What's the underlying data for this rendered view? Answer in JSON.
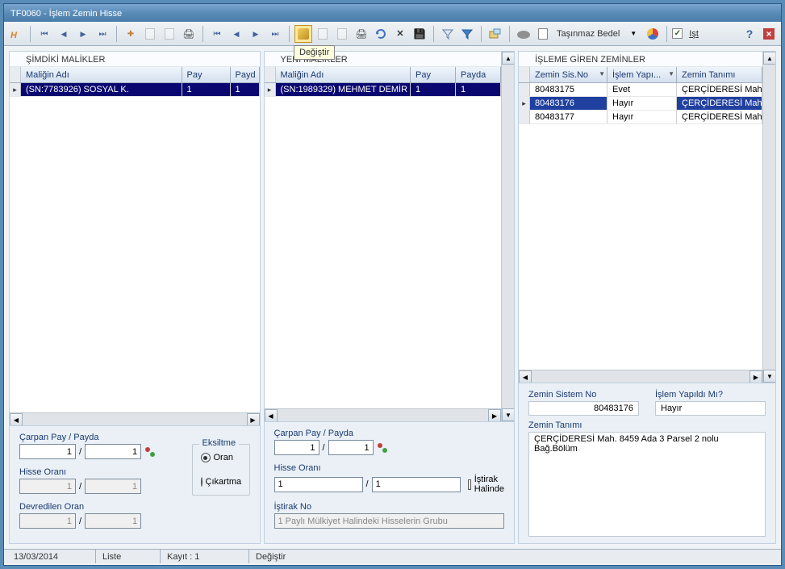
{
  "title": "TF0060 - İşlem Zemin Hisse",
  "toolbar": {
    "tasinmaz_label": "Taşınmaz Bedel",
    "ist_label": "Işt",
    "tooltip_degistir": "Değiştir"
  },
  "p1": {
    "header": "ŞİMDİKİ MALİKLER",
    "cols": {
      "c1": "Maliğin Adı",
      "c2": "Pay",
      "c3": "Payd"
    },
    "row1": {
      "name": "(SN:7783926) SOSYAL K.",
      "pay": "1",
      "payda": "1"
    },
    "form": {
      "carpan_label": "Çarpan Pay / Payda",
      "carpan_pay": "1",
      "carpan_payda": "1",
      "hisse_label": "Hisse Oranı",
      "hisse_pay": "1",
      "hisse_payda": "1",
      "devr_label": "Devredilen Oran",
      "devr_pay": "1",
      "devr_payda": "1",
      "eksiltme": "Eksiltme",
      "oran": "Oran",
      "cikartma": "Çıkartma"
    }
  },
  "p2": {
    "header": "YENİ MALİKLER",
    "cols": {
      "c1": "Maliğin Adı",
      "c2": "Pay",
      "c3": "Payda"
    },
    "row1": {
      "name": "(SN:1989329) MEHMET DEMİR",
      "pay": "1",
      "payda": "1"
    },
    "form": {
      "carpan_label": "Çarpan Pay / Payda",
      "carpan_pay": "1",
      "carpan_payda": "1",
      "hisse_label": "Hisse Oranı",
      "hisse_pay": "1",
      "hisse_payda": "1",
      "istirak_check": "İştirak Halinde",
      "istirak_no_label": "İştirak No",
      "istirak_no": "1 Paylı Mülkiyet Halindeki Hisselerin Grubu"
    }
  },
  "p3": {
    "header": "İŞLEME GİREN ZEMİNLER",
    "cols": {
      "c1": "Zemin Sis.No",
      "c2": "İşlem Yapı...",
      "c3": "Zemin Tanımı"
    },
    "rows": [
      {
        "sis": "80483175",
        "islem": "Evet",
        "tanim": "ÇERÇİDERESİ Mah."
      },
      {
        "sis": "80483176",
        "islem": "Hayır",
        "tanim": "ÇERÇİDERESİ Mah."
      },
      {
        "sis": "80483177",
        "islem": "Hayır",
        "tanim": "ÇERÇİDERESİ Mah."
      }
    ],
    "detail": {
      "sis_label": "Zemin Sistem No",
      "sis_value": "80483176",
      "islem_label": "İşlem Yapıldı Mı?",
      "islem_value": "Hayır",
      "tanim_label": "Zemin Tanımı",
      "tanim_value": "ÇERÇİDERESİ Mah. 8459 Ada 3 Parsel 2 nolu Bağ.Bölüm"
    }
  },
  "status": {
    "date": "13/03/2014",
    "liste": "Liste",
    "kayit": "Kayıt : 1",
    "mode": "Değiştir"
  }
}
